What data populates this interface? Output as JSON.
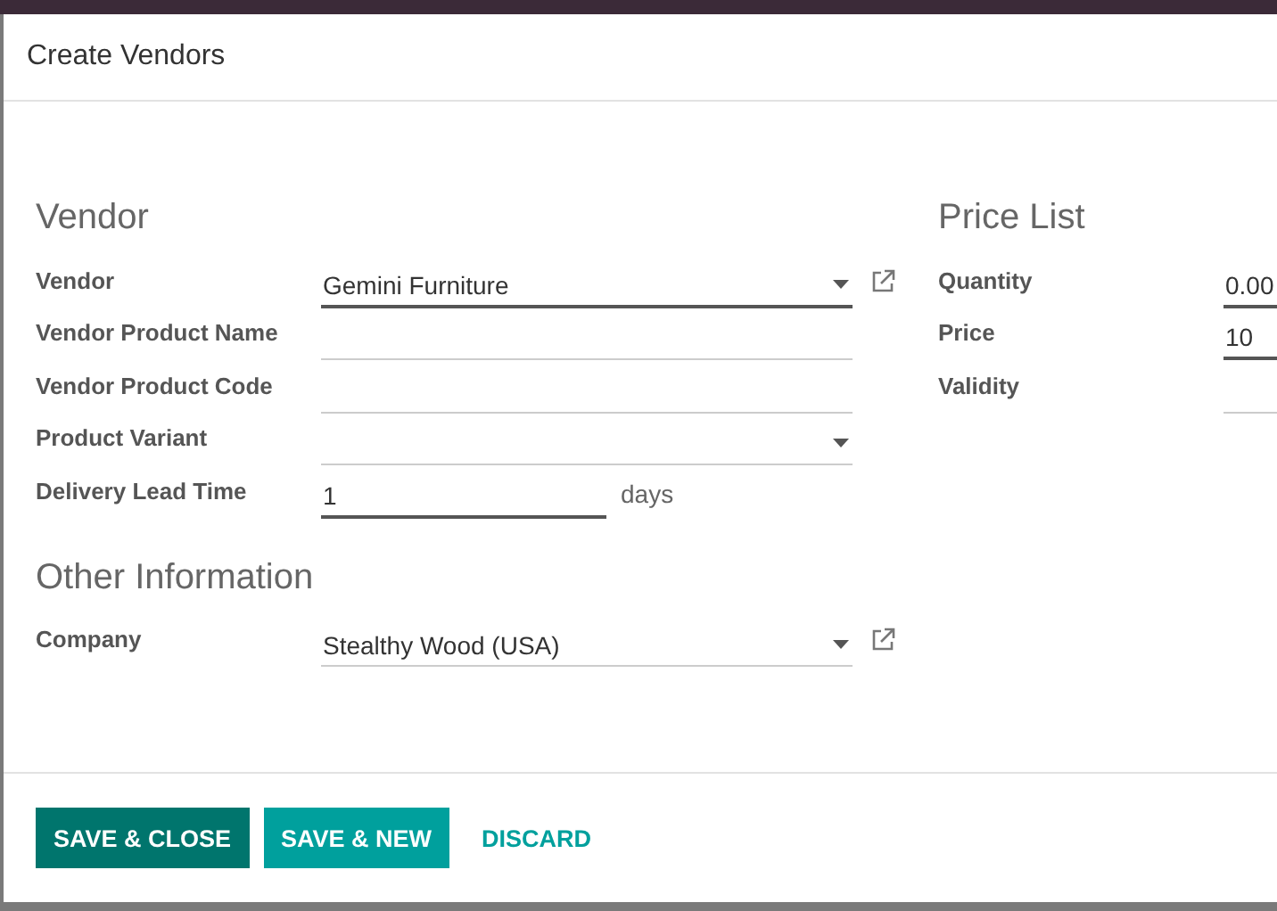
{
  "dialog": {
    "title": "Create Vendors"
  },
  "sections": [
    {
      "heading": "Vendor",
      "fields": [
        {
          "label": "Vendor",
          "kind": "select",
          "value": "Gemini Furniture",
          "required": true,
          "external_link": true
        },
        {
          "label": "Vendor Product Name",
          "kind": "text",
          "required": false
        },
        {
          "label": "Vendor Product Code",
          "kind": "text",
          "required": false
        },
        {
          "label": "Product Variant",
          "kind": "select",
          "required": false
        },
        {
          "label": "Delivery Lead Time",
          "kind": "unit",
          "value": "1",
          "unit": "days",
          "required": true
        }
      ]
    },
    {
      "heading": "Other Information",
      "fields": [
        {
          "label": "Company",
          "kind": "select",
          "value": "Stealthy Wood (USA)",
          "required": false,
          "external_link": true
        }
      ]
    }
  ],
  "price_list": {
    "heading": "Price List",
    "fields": [
      {
        "label": "Quantity",
        "value": "0.00",
        "required": true
      },
      {
        "label": "Price",
        "value": "10",
        "required": true
      },
      {
        "label": "Validity",
        "required": false
      }
    ]
  },
  "buttons": [
    {
      "label": "SAVE & CLOSE",
      "kind": "primary"
    },
    {
      "label": "SAVE & NEW",
      "kind": "secondary"
    },
    {
      "label": "DISCARD",
      "kind": "link"
    }
  ]
}
